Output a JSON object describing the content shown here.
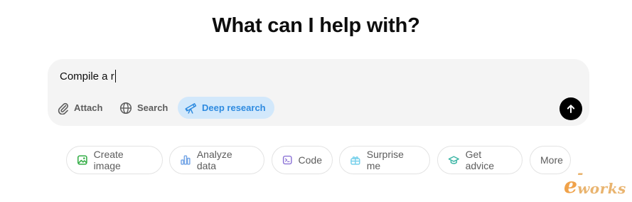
{
  "heading": "What can I help with?",
  "composer": {
    "input_value": "Compile a r",
    "tools": [
      {
        "label": "Attach",
        "icon": "paperclip-icon"
      },
      {
        "label": "Search",
        "icon": "globe-icon"
      },
      {
        "label": "Deep research",
        "icon": "telescope-icon",
        "active": true
      }
    ],
    "send_icon": "arrow-up-icon"
  },
  "suggestions": [
    {
      "label": "Create image",
      "icon": "image-icon",
      "color": "#35ae47"
    },
    {
      "label": "Analyze data",
      "icon": "bar-chart-icon",
      "color": "#76a6e6"
    },
    {
      "label": "Code",
      "icon": "terminal-icon",
      "color": "#8c73d6"
    },
    {
      "label": "Surprise me",
      "icon": "gift-icon",
      "color": "#76d0eb"
    },
    {
      "label": "Get advice",
      "icon": "graduation-cap-icon",
      "color": "#3fb7a7"
    },
    {
      "label": "More",
      "icon": ""
    }
  ],
  "watermark": {
    "prefix": "e",
    "rest": "-works"
  },
  "colors": {
    "accent": "#2f8be0",
    "accent_bg": "#d2e8fb",
    "composer_bg": "#f4f4f4"
  }
}
